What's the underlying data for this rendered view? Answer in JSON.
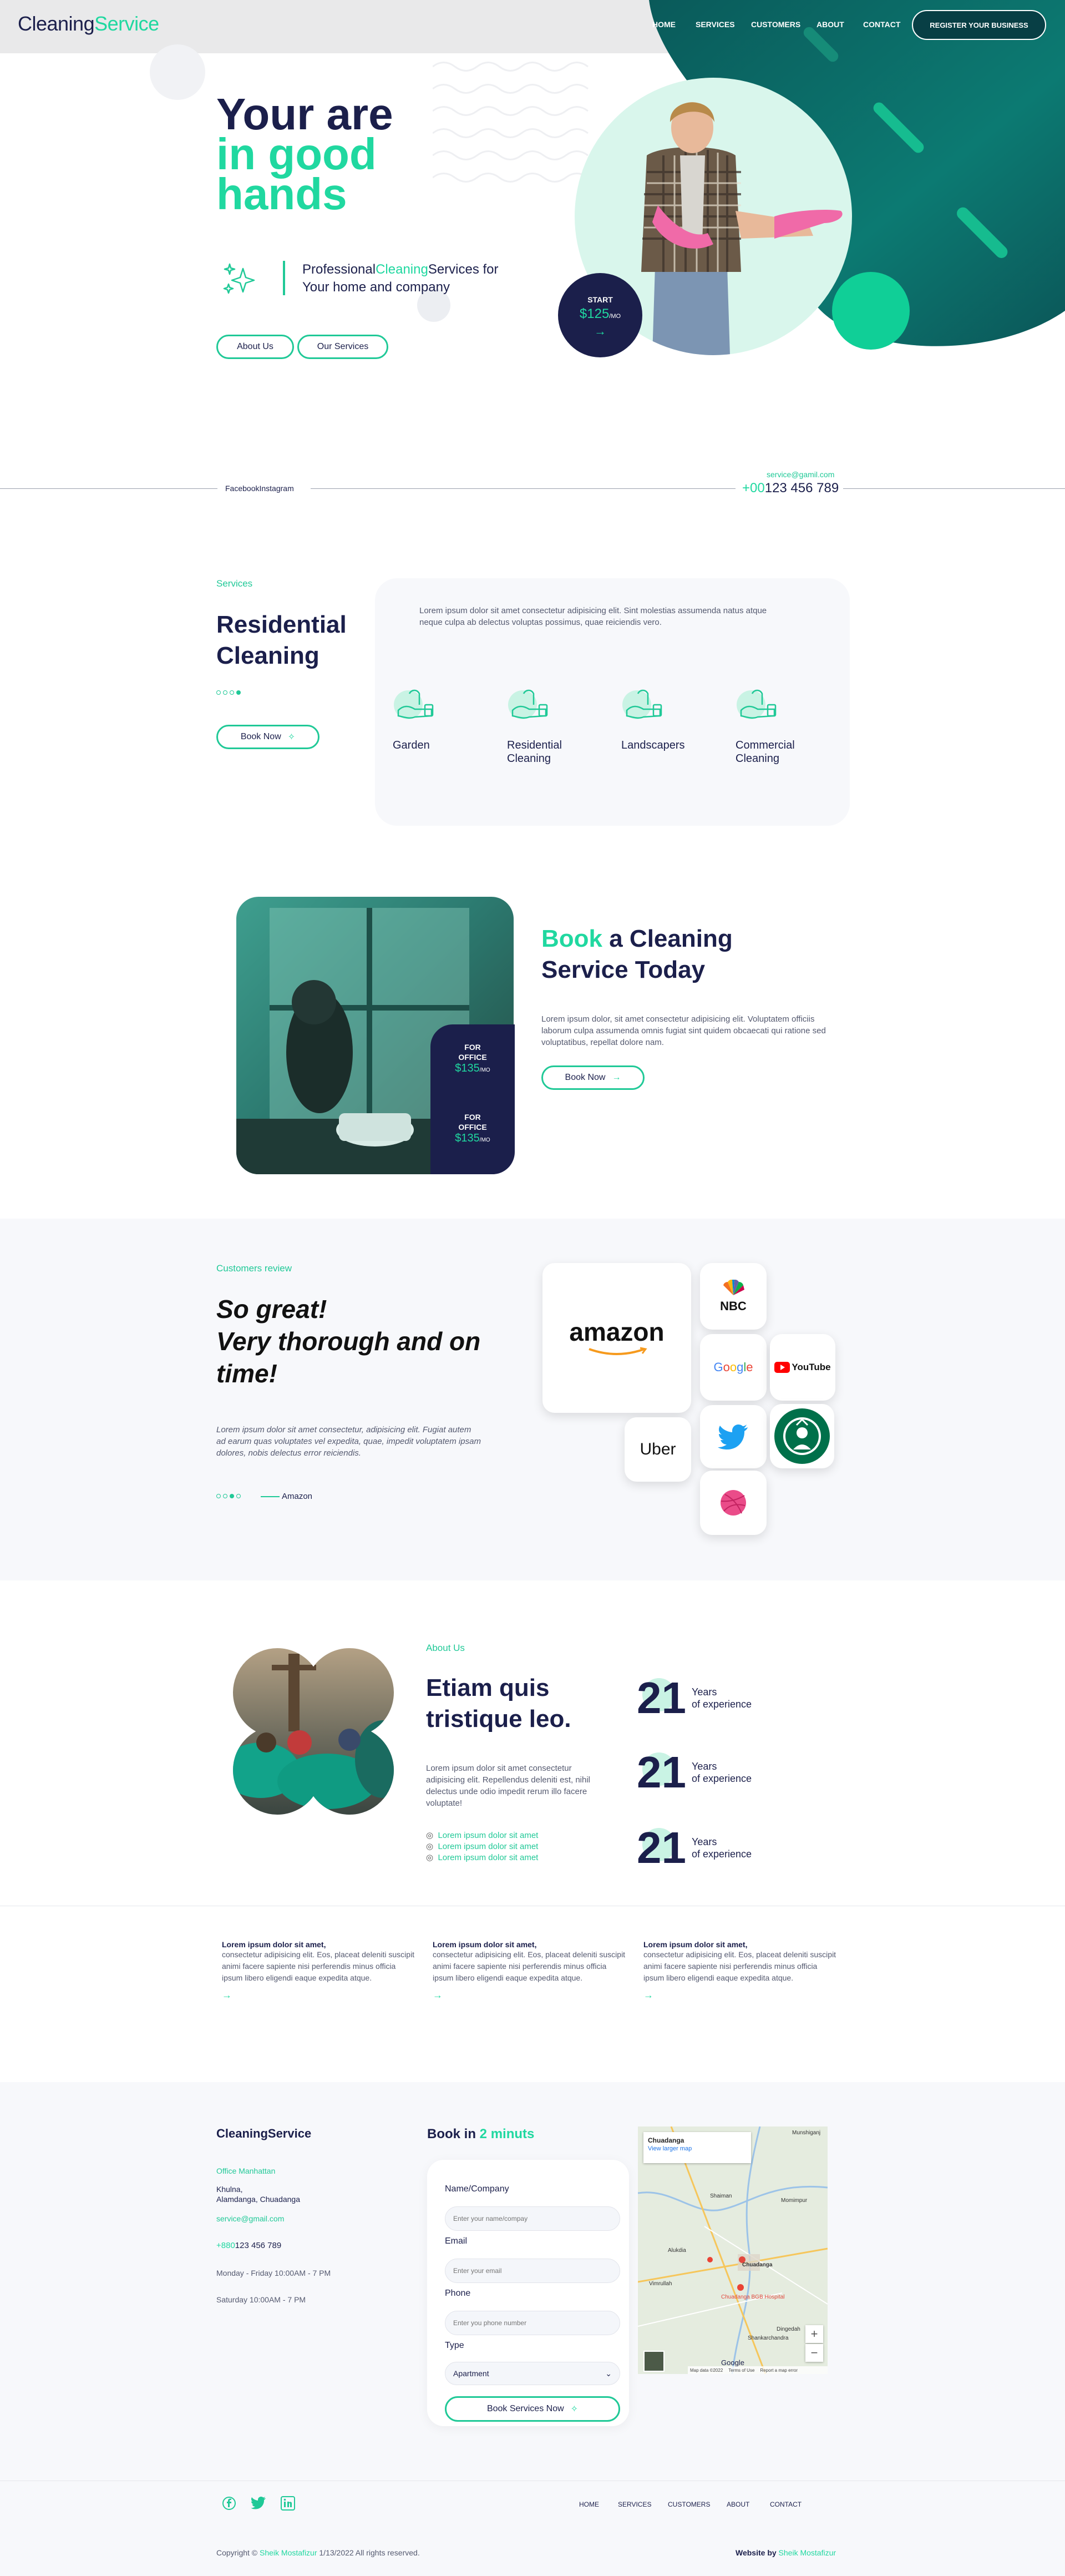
{
  "header": {
    "brand_dark": "Cleaning",
    "brand_green": "Service",
    "nav": [
      "HOME",
      "SERVICES",
      "CUSTOMERS",
      "ABOUT",
      "CONTACT"
    ],
    "register_label": "REGISTER YOUR BUSINESS"
  },
  "hero": {
    "title_line1": "Your are",
    "title_line2": "in good",
    "title_line3": "hands",
    "sub_a": "Professional",
    "sub_b": "Cleaning",
    "sub_c": "Services for",
    "sub_line2": "Your home and company",
    "about_btn": "About Us",
    "services_btn": "Our Services",
    "start_label": "START",
    "start_price": "$125",
    "start_unit": "/MO"
  },
  "social_bar": {
    "links": "FacebookInstagram",
    "email": "service@gamil.com",
    "phone_prefix": "+00",
    "phone": "123 456 789"
  },
  "services": {
    "label": "Services",
    "title_line1": "Residential",
    "title_line2": "Cleaning",
    "book_btn": "Book Now",
    "description": "Lorem ipsum dolor sit amet consectetur adipisicing elit. Sint molestias assumenda natus atque neque culpa ab delectus voluptas possimus, quae reiciendis vero.",
    "items": [
      {
        "line1": "Garden",
        "line2": ""
      },
      {
        "line1": "Residential",
        "line2": "Cleaning"
      },
      {
        "line1": "Landscapers",
        "line2": ""
      },
      {
        "line1": "Commercial",
        "line2": "Cleaning"
      }
    ]
  },
  "booking": {
    "title_green": "Book",
    "title_rest": "a Cleaning",
    "title_line2": "Service Today",
    "description": "Lorem ipsum dolor, sit amet consectetur adipisicing elit. Voluptatem officiis laborum culpa assumenda omnis fugiat sint quidem obcaecati qui ratione sed voluptatibus, repellat dolore nam.",
    "book_btn": "Book Now",
    "offers": [
      {
        "line1": "FOR",
        "line2": "OFFICE",
        "price": "$135",
        "unit": "/MO"
      },
      {
        "line1": "FOR",
        "line2": "OFFICE",
        "price": "$135",
        "unit": "/MO"
      }
    ]
  },
  "review": {
    "label": "Customers review",
    "quote_line1": "So great!",
    "quote_line2": "Very thorough and on",
    "quote_line3": "time!",
    "text": "Lorem ipsum dolor sit amet consectetur, adipisicing elit. Fugiat autem ad earum quas voluptates vel expedita, quae, impedit voluptatem ipsam dolores, nobis delectus error reiciendis.",
    "author": "Amazon",
    "logos": [
      "amazon",
      "NBC",
      "Google",
      "YouTube",
      "Uber",
      "twitter-bird",
      "starbucks",
      "dribbble"
    ]
  },
  "about": {
    "label": "About Us",
    "title_line1": "Etiam quis",
    "title_line2": "tristique leo.",
    "description": "Lorem ipsum dolor sit amet consectetur adipisicing elit. Repellendus deleniti est, nihil delectus unde odio impedit rerum illo facere voluptate!",
    "list": [
      "Lorem ipsum dolor sit amet",
      "Lorem ipsum dolor sit amet",
      "Lorem ipsum dolor sit amet"
    ],
    "stats": [
      {
        "num": "21",
        "l1": "Years",
        "l2": "of experience"
      },
      {
        "num": "21",
        "l1": "Years",
        "l2": "of experience"
      },
      {
        "num": "21",
        "l1": "Years",
        "l2": "of experience"
      }
    ]
  },
  "features": [
    {
      "title": "Lorem ipsum dolor sit amet,",
      "body": "consectetur adipisicing elit. Eos, placeat deleniti suscipit animi facere sapiente nisi perferendis minus officia ipsum libero eligendi eaque expedita atque."
    },
    {
      "title": "Lorem ipsum dolor sit amet,",
      "body": "consectetur adipisicing elit. Eos, placeat deleniti suscipit animi facere sapiente nisi perferendis minus officia ipsum libero eligendi eaque expedita atque."
    },
    {
      "title": "Lorem ipsum dolor sit amet,",
      "body": "consectetur adipisicing elit. Eos, placeat deleniti suscipit animi facere sapiente nisi perferendis minus officia ipsum libero eligendi eaque expedita atque."
    }
  ],
  "contact": {
    "brand": "CleaningService",
    "office_label": "Office Manhattan",
    "addr1": "Khulna,",
    "addr2": "Alamdanga, Chuadanga",
    "email": "service@gmail.com",
    "phone_prefix": "+880",
    "phone": "123 456 789",
    "hours1": "Monday - Friday 10:00AM - 7 PM",
    "hours2": "Saturday 10:00AM - 7 PM",
    "form_title_a": "Book in",
    "form_title_b": "2 minuts",
    "fields": [
      {
        "label": "Name/Company",
        "placeholder": "Enter your name/compay"
      },
      {
        "label": "Email",
        "placeholder": "Enter your email"
      },
      {
        "label": "Phone",
        "placeholder": "Enter you phone number"
      }
    ],
    "type_label": "Type",
    "type_value": "Apartment",
    "submit": "Book Services Now",
    "map": {
      "title": "Chuadanga",
      "link": "View larger map",
      "places": [
        "Munshiganj",
        "Alukdia",
        "Shaiman",
        "Momimpur",
        "Vimrullah",
        "Chuadanga",
        "Dingedah",
        "Shankarchandra",
        "Chuadanga BGB Hospital"
      ],
      "footer": [
        "Map data ©2022",
        "Terms of Use",
        "Report a map error"
      ],
      "google": "Google"
    }
  },
  "footer": {
    "nav": [
      "HOME",
      "SERVICES",
      "CUSTOMERS",
      "ABOUT",
      "CONTACT"
    ],
    "copyright_a": "Copyright ©",
    "copyright_name": "Sheik Mostafizur",
    "copyright_b": "1/13/2022 All rights reserved.",
    "website_by": "Website by",
    "website_name": "Sheik Mostafizur"
  }
}
